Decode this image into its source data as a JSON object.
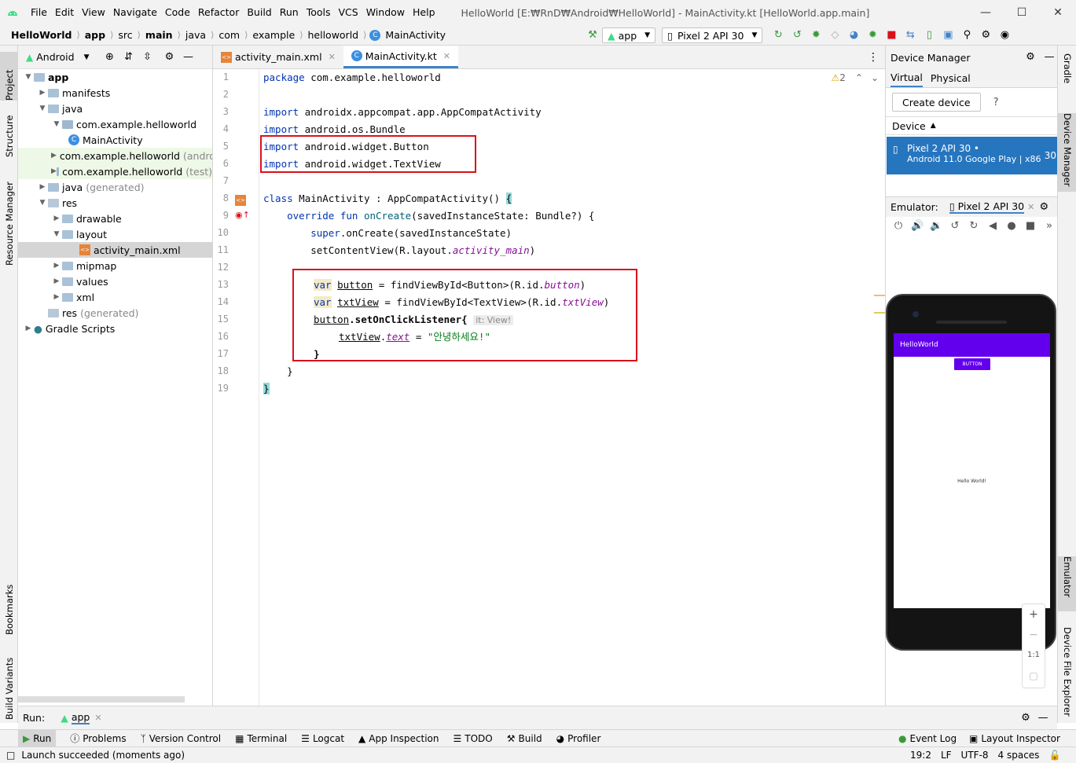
{
  "menu": [
    "File",
    "Edit",
    "View",
    "Navigate",
    "Code",
    "Refactor",
    "Build",
    "Run",
    "Tools",
    "VCS",
    "Window",
    "Help"
  ],
  "window_title": "HelloWorld [E:₩RnD₩Android₩HelloWorld] - MainActivity.kt [HelloWorld.app.main]",
  "breadcrumb": [
    "HelloWorld",
    "app",
    "src",
    "main",
    "java",
    "com",
    "example",
    "helloworld",
    "MainActivity"
  ],
  "toolbar": {
    "run_config": "app",
    "device": "Pixel 2 API 30"
  },
  "left_tabs": [
    "Project",
    "Structure",
    "Resource Manager",
    "Bookmarks",
    "Build Variants"
  ],
  "right_tabs": [
    "Gradle",
    "Device Manager",
    "Emulator",
    "Device File Explorer"
  ],
  "project": {
    "view": "Android",
    "tree": [
      {
        "label": "app",
        "bold": true
      },
      {
        "label": "manifests"
      },
      {
        "label": "java"
      },
      {
        "label": "com.example.helloworld"
      },
      {
        "label": "MainActivity"
      },
      {
        "label": "com.example.helloworld",
        "suffix": "(andro"
      },
      {
        "label": "com.example.helloworld",
        "suffix": "(test)"
      },
      {
        "label": "java",
        "suffix": "(generated)"
      },
      {
        "label": "res"
      },
      {
        "label": "drawable"
      },
      {
        "label": "layout"
      },
      {
        "label": "activity_main.xml"
      },
      {
        "label": "mipmap"
      },
      {
        "label": "values"
      },
      {
        "label": "xml"
      },
      {
        "label": "res",
        "suffix": "(generated)"
      },
      {
        "label": "Gradle Scripts"
      }
    ]
  },
  "editor": {
    "tabs": [
      "activity_main.xml",
      "MainActivity.kt"
    ],
    "warnings": "2",
    "line_numbers": [
      "1",
      "2",
      "3",
      "4",
      "5",
      "6",
      "7",
      "8",
      "9",
      "10",
      "11",
      "12",
      "13",
      "14",
      "15",
      "16",
      "17",
      "18",
      "19"
    ],
    "lines": {
      "l1a": "package",
      "l1b": " com.example.helloworld",
      "l3a": "import",
      "l3b": " androidx.appcompat.app.AppCompatActivity",
      "l4a": "import",
      "l4b": " android.os.Bundle",
      "l5a": "import",
      "l5b": " android.widget.Button",
      "l6a": "import",
      "l6b": " android.widget.TextView",
      "l8a": "class",
      "l8b": " MainActivity : AppCompatActivity() ",
      "l8c": "{",
      "l9a": "    override fun ",
      "l9b": "onCreate",
      "l9c": "(savedInstanceState: Bundle?) {",
      "l10a": "        super",
      "l10b": ".onCreate(savedInstanceState)",
      "l11a": "        setContentView(R.layout.",
      "l11b": "activity_main",
      "l11c": ")",
      "l13a": "var",
      "l13b": "button",
      "l13c": " = findViewById<Button>(R.id.",
      "l13d": "button",
      "l13e": ")",
      "l14a": "var",
      "l14b": "txtView",
      "l14c": " = findViewById<TextView>(R.id.",
      "l14d": "txtView",
      "l14e": ")",
      "l15a": "button",
      "l15b": ".setOnClickListener{",
      "l15hint": "it: View!",
      "l16a": "txtView",
      "l16b": ".",
      "l16c": "text",
      "l16d": " = ",
      "l16e": "\"안녕하세요!\"",
      "l17": "}",
      "l18": "    }",
      "l19": "}"
    }
  },
  "device_manager": {
    "title": "Device Manager",
    "tabs": [
      "Virtual",
      "Physical"
    ],
    "create_button": "Create device",
    "help": "?",
    "column": "Device",
    "device_name": "Pixel 2 API 30",
    "device_sub": "Android 11.0 Google Play | x86",
    "api": "30"
  },
  "emulator": {
    "label": "Emulator:",
    "tab": "Pixel 2 API 30",
    "app_title": "HelloWorld",
    "button_text": "BUTTON",
    "hello_text": "Hello World!",
    "zoom": [
      "+",
      "−",
      "1:1",
      "▢"
    ]
  },
  "run": {
    "label": "Run:",
    "config": "app"
  },
  "tool_windows": [
    "Run",
    "Problems",
    "Version Control",
    "Terminal",
    "Logcat",
    "App Inspection",
    "TODO",
    "Build",
    "Profiler"
  ],
  "tool_windows_right": [
    "Event Log",
    "Layout Inspector"
  ],
  "status": {
    "message": "Launch succeeded (moments ago)",
    "position": "19:2",
    "line_sep": "LF",
    "encoding": "UTF-8",
    "indent": "4 spaces"
  },
  "colors": {
    "accent": "#4083c9",
    "selected_device": "#2675bf",
    "app_purple": "#6200ee",
    "red_box": "#d9111b",
    "keyword": "#0033b3"
  }
}
